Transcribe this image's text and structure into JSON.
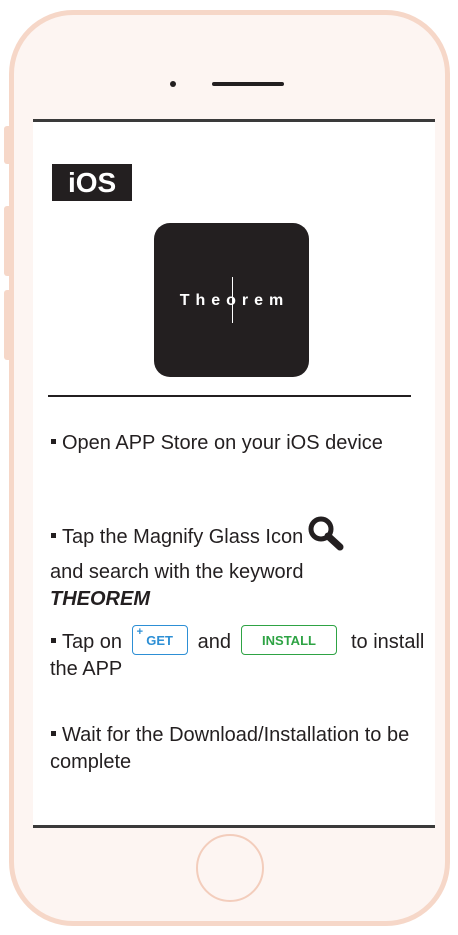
{
  "platform": {
    "label": "iOS"
  },
  "app": {
    "logo_text": "Theorem"
  },
  "steps": {
    "step1": "Open APP Store on your iOS device",
    "step2_text": "Tap the Magnify Glass Icon",
    "step2_rest": "and search with the keyword",
    "step2_keyword": "THEOREM",
    "step3_prefix": "Tap on",
    "step3_and": "and",
    "step3_suffix": "to install the APP",
    "step4": "Wait for the Download/Installation to be complete"
  },
  "buttons": {
    "get_plus": "+",
    "get_label": "GET",
    "install_label": "INSTALL"
  },
  "icons": {
    "search": "magnify-glass-icon"
  },
  "colors": {
    "frame": "#f6d7c8",
    "frame_bg": "#fdf5f2",
    "dark": "#231f20",
    "get_blue": "#2d8fd5",
    "install_green": "#2ea344"
  }
}
